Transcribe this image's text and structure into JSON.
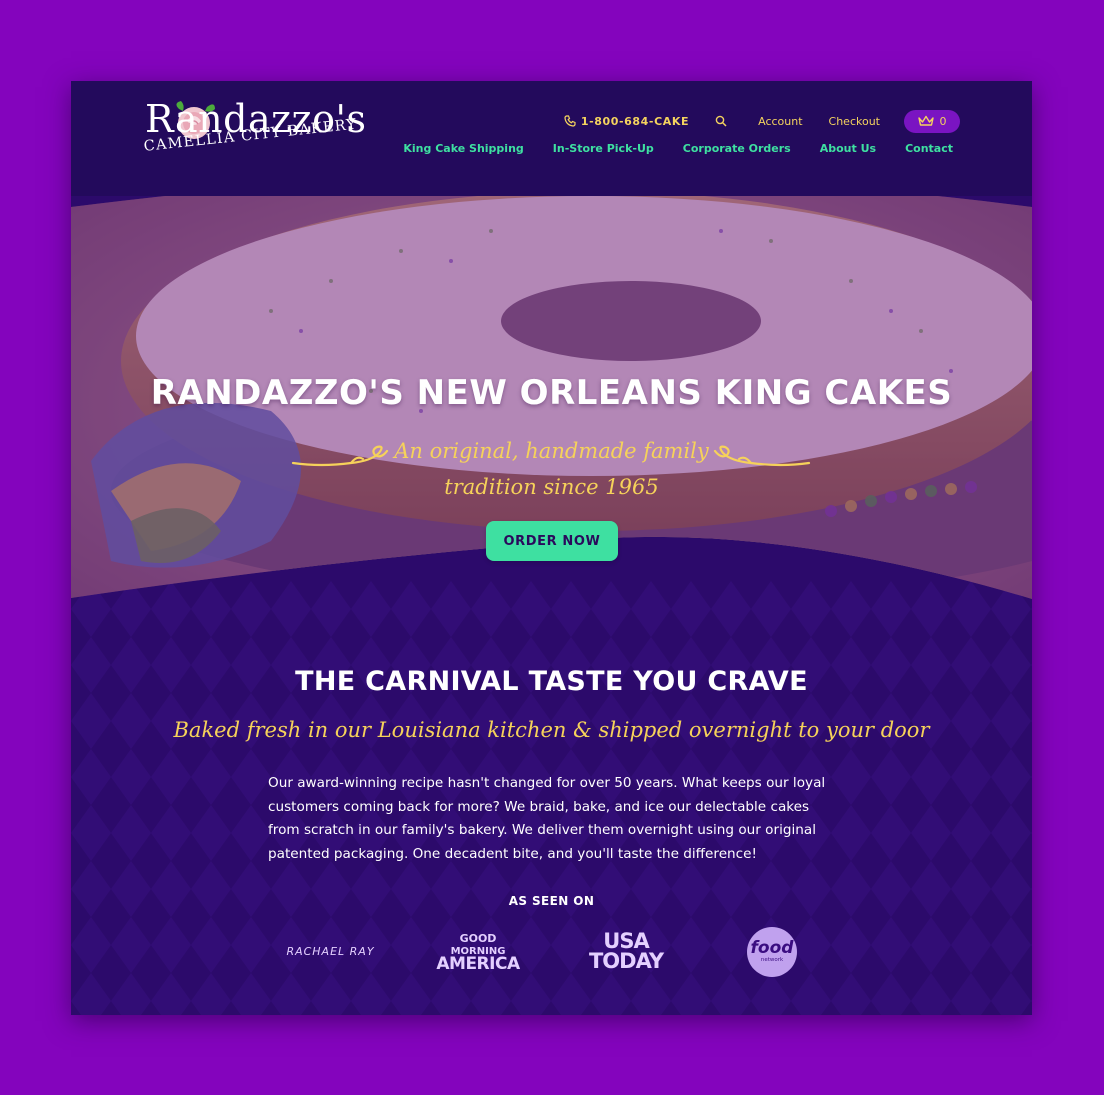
{
  "brand": {
    "name": "Randazzo's",
    "subtitle": "CAMELLIA CITY BAKERY"
  },
  "utility_nav": {
    "phone": "1-800-684-CAKE",
    "account": "Account",
    "checkout": "Checkout",
    "cart_count": "0"
  },
  "main_nav": [
    "King Cake Shipping",
    "In-Store Pick-Up",
    "Corporate Orders",
    "About Us",
    "Contact"
  ],
  "hero": {
    "title": "RANDAZZO'S NEW ORLEANS KING CAKES",
    "tagline": "An original, handmade family tradition since 1965",
    "cta": "ORDER NOW"
  },
  "intro": {
    "title": "THE CARNIVAL TASTE YOU CRAVE",
    "subtitle": "Baked fresh in our Louisiana kitchen & shipped overnight to your door",
    "body": "Our award-winning recipe hasn't changed for over 50 years. What keeps our loyal customers coming back for more? We braid, bake, and ice our delectable cakes from scratch in our family's bakery. We deliver them overnight using our original patented packaging. One decadent bite, and you'll taste the difference!"
  },
  "press": {
    "heading": "AS SEEN ON",
    "rachael_ray": "RACHAEL RAY",
    "gma": [
      "GOOD",
      "MORNING",
      "AMERICA"
    ],
    "usa_today": [
      "USA",
      "TODAY"
    ],
    "food_network": [
      "food",
      "network"
    ]
  },
  "colors": {
    "page_bg": "#8404bd",
    "header_bg": "#230a5c",
    "section_bg": "#2c0a6b",
    "accent_gold": "#f6d25a",
    "accent_green": "#3ee0a1",
    "cart_bg": "#7a14c2"
  }
}
